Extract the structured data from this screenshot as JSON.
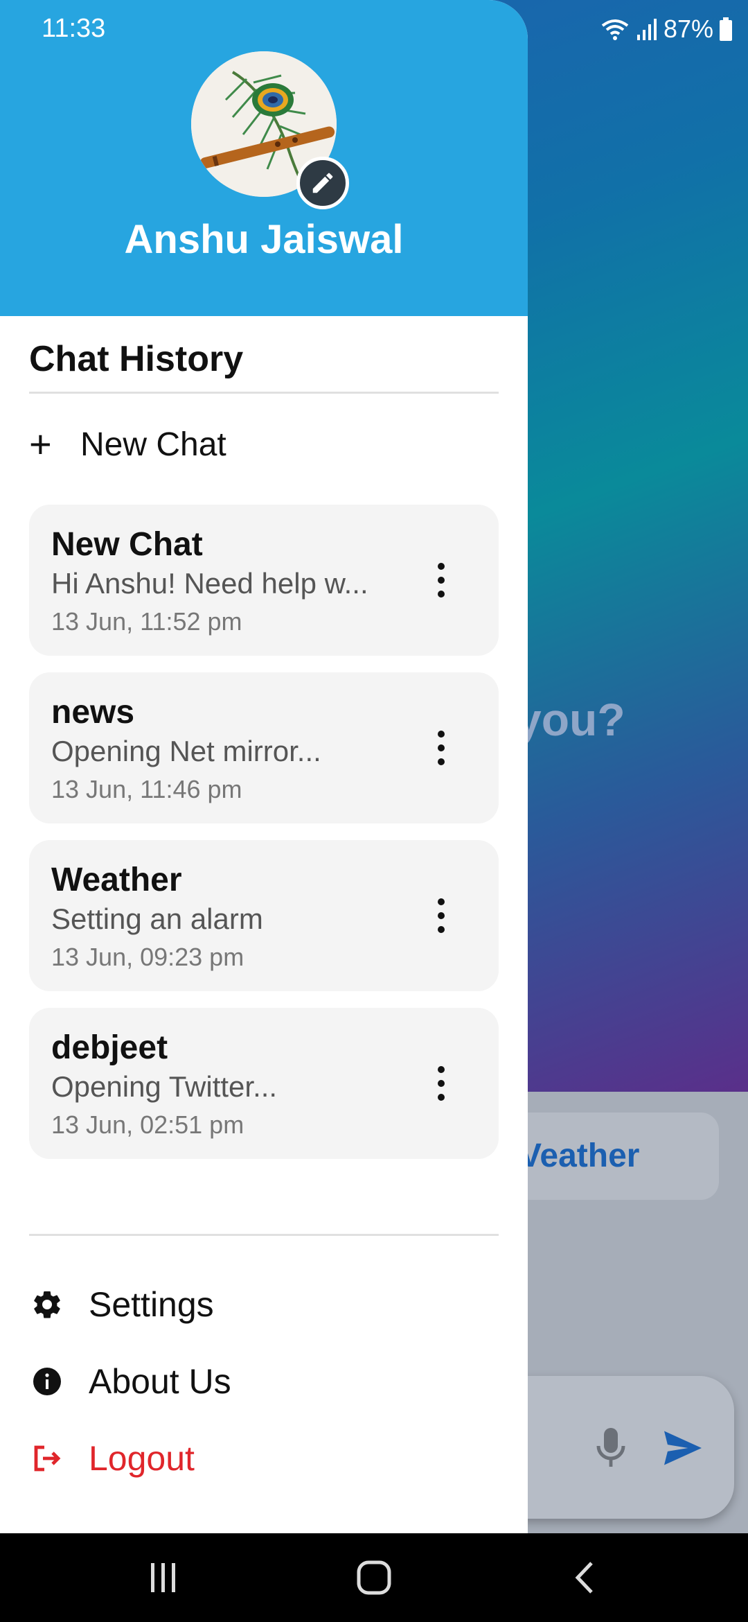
{
  "status_bar": {
    "time": "11:33",
    "battery": "87%"
  },
  "background": {
    "question_fragment": "you?",
    "chip_label": "Veather"
  },
  "drawer": {
    "user_name": "Anshu Jaiswal",
    "section_title": "Chat History",
    "new_chat_label": "New Chat",
    "chats": [
      {
        "title": "New Chat",
        "preview": "Hi Anshu! Need help w...",
        "time": "13 Jun, 11:52 pm"
      },
      {
        "title": "news",
        "preview": "Opening Net mirror...",
        "time": "13 Jun, 11:46 pm"
      },
      {
        "title": "Weather",
        "preview": "Setting an alarm",
        "time": "13 Jun, 09:23 pm"
      },
      {
        "title": "debjeet",
        "preview": "Opening Twitter...",
        "time": "13 Jun, 02:51 pm"
      }
    ],
    "menu": [
      {
        "label": "Settings",
        "icon": "gear-icon"
      },
      {
        "label": "About Us",
        "icon": "info-icon"
      },
      {
        "label": "Logout",
        "icon": "logout-icon"
      }
    ]
  },
  "colors": {
    "header": "#27a5e0",
    "logout": "#e0262b",
    "accent_blue": "#1b5fb0"
  }
}
